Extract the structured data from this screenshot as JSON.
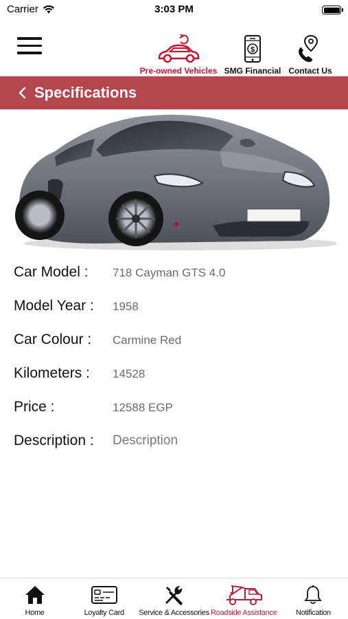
{
  "status_bar": {
    "carrier": "Carrier",
    "time": "3:03 PM"
  },
  "top_nav": {
    "items": [
      {
        "label": "Pre-owned Vehicles",
        "icon": "car-sync-icon",
        "active": true
      },
      {
        "label": "SMG Financial",
        "icon": "phone-dollar-icon"
      },
      {
        "label": "Contact Us",
        "icon": "phone-location-icon"
      }
    ]
  },
  "header": {
    "title": "Specifications"
  },
  "specs": [
    {
      "label": "Car Model :",
      "value": "718 Cayman GTS 4.0"
    },
    {
      "label": "Model Year :",
      "value": "1958"
    },
    {
      "label": "Car Colour :",
      "value": "Carmine Red"
    },
    {
      "label": "Kilometers :",
      "value": "14528"
    },
    {
      "label": "Price :",
      "value": "12588 EGP"
    },
    {
      "label": "Description :",
      "value": "Description"
    }
  ],
  "tabs": [
    {
      "label": "Home",
      "icon": "home-icon"
    },
    {
      "label": "Loyalty Card",
      "icon": "card-icon"
    },
    {
      "label": "Service & Accessories",
      "icon": "tools-icon"
    },
    {
      "label": "Roadside Assistance",
      "icon": "tow-truck-icon",
      "active": true
    },
    {
      "label": "Notification",
      "icon": "bell-icon"
    }
  ],
  "colors": {
    "accent": "#c8102e",
    "header_bg": "#b5454d",
    "car_body": "#6f7680"
  }
}
